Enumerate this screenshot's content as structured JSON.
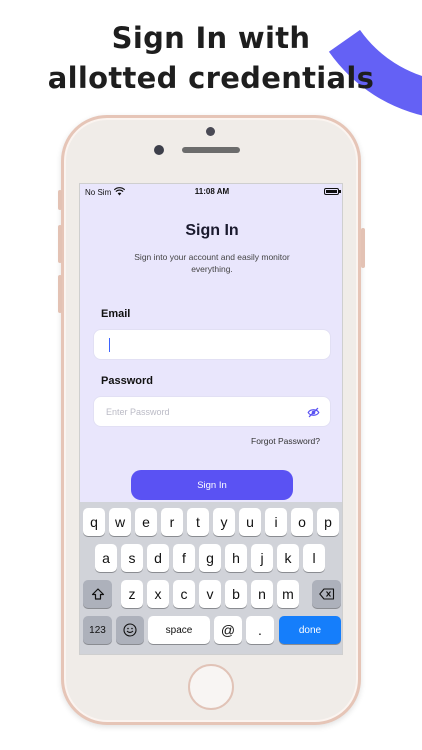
{
  "promo": {
    "line1": "Sign In with",
    "line2": "allotted credentials"
  },
  "colors": {
    "accent": "#6461f5",
    "button": "#5a52f3",
    "screen_bg": "#e9e6fc",
    "done_key": "#157efb"
  },
  "status": {
    "carrier": "No Sim",
    "time": "11:08 AM"
  },
  "signin": {
    "title": "Sign In",
    "subtitle": "Sign into your account and easily monitor everything.",
    "email_label": "Email",
    "email_value": "",
    "password_label": "Password",
    "password_placeholder": "Enter Password",
    "forgot": "Forgot Password?",
    "button": "Sign In"
  },
  "keyboard": {
    "row1": [
      "q",
      "w",
      "e",
      "r",
      "t",
      "y",
      "u",
      "i",
      "o",
      "p"
    ],
    "row2": [
      "a",
      "s",
      "d",
      "f",
      "g",
      "h",
      "j",
      "k",
      "l"
    ],
    "row3": [
      "z",
      "x",
      "c",
      "v",
      "b",
      "n",
      "m"
    ],
    "numbers": "123",
    "space": "space",
    "at": "@",
    "dot": ".",
    "done": "done"
  },
  "icons": {
    "wifi": "wifi-icon",
    "battery": "battery-icon",
    "eye": "eye-slash-icon",
    "shift": "shift-icon",
    "backspace": "backspace-icon",
    "emoji": "emoji-icon"
  }
}
